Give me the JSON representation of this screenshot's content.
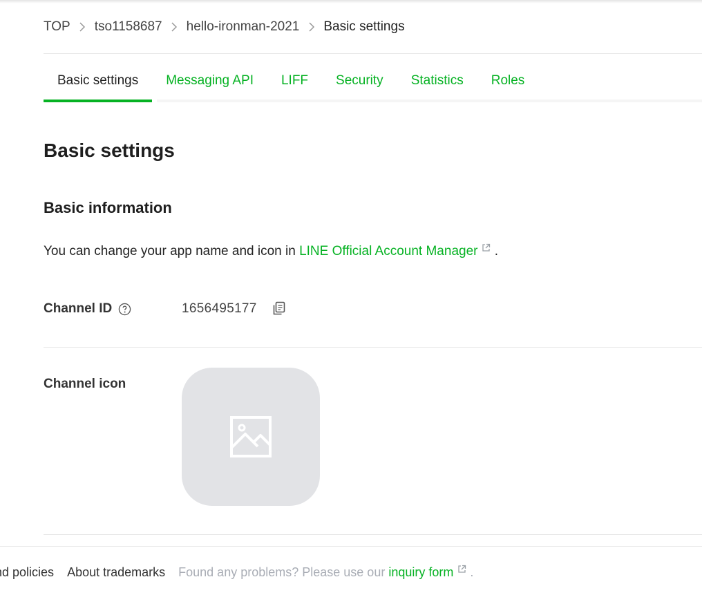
{
  "breadcrumb": {
    "items": [
      "TOP",
      "tso1158687",
      "hello-ironman-2021",
      "Basic settings"
    ]
  },
  "tabs": [
    {
      "label": "Basic settings",
      "active": true
    },
    {
      "label": "Messaging API",
      "active": false
    },
    {
      "label": "LIFF",
      "active": false
    },
    {
      "label": "Security",
      "active": false
    },
    {
      "label": "Statistics",
      "active": false
    },
    {
      "label": "Roles",
      "active": false
    }
  ],
  "page_title": "Basic settings",
  "basic_information": {
    "title": "Basic information",
    "text_before": "You can change your app name and icon in ",
    "link_text": "LINE Official Account Manager",
    "text_after": " ."
  },
  "channel_id": {
    "label": "Channel ID",
    "value": "1656495177"
  },
  "channel_icon": {
    "label": "Channel icon"
  },
  "footer": {
    "link1": "nd policies",
    "link2": "About trademarks",
    "note_before": "Found any problems? Please use our ",
    "note_link": "inquiry form",
    "note_after": " ."
  },
  "colors": {
    "accent": "#06b223",
    "placeholder_bg": "#e2e3e6"
  },
  "icons": [
    "chevron-right-icon",
    "external-link-icon",
    "help-icon",
    "copy-icon",
    "image-placeholder-icon"
  ]
}
